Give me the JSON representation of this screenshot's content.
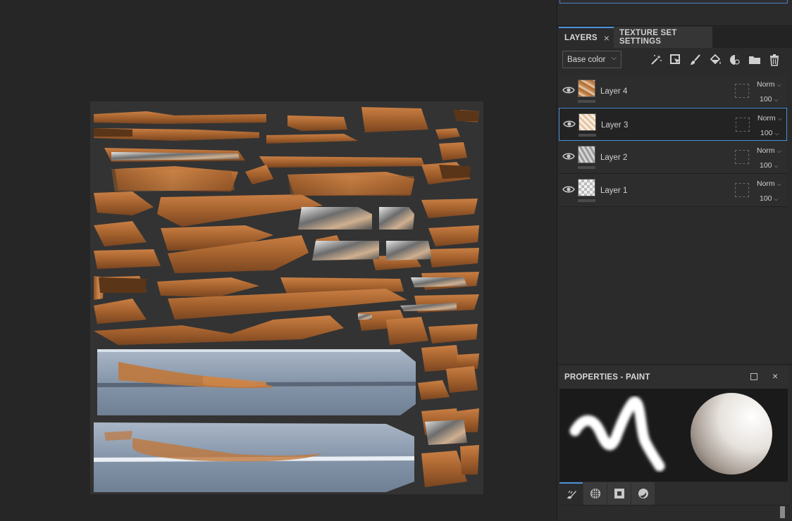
{
  "viewport": {
    "content": "uv-texture-map"
  },
  "layers_panel": {
    "tabs": [
      {
        "label": "LAYERS",
        "active": true
      },
      {
        "label": "TEXTURE SET SETTINGS",
        "active": false
      }
    ],
    "close_glyph": "×",
    "channel": {
      "selected": "Base color"
    },
    "tools": [
      "magic-wand-icon",
      "fill-layer-icon",
      "brush-icon",
      "paint-bucket-icon",
      "mask-icon",
      "folder-icon",
      "trash-icon"
    ],
    "layers": [
      {
        "name": "Layer 4",
        "blend": "Norm",
        "opacity": "100",
        "thumb": "brown",
        "selected": false
      },
      {
        "name": "Layer 3",
        "blend": "Norm",
        "opacity": "100",
        "thumb": "orange",
        "selected": true
      },
      {
        "name": "Layer 2",
        "blend": "Norm",
        "opacity": "100",
        "thumb": "gray",
        "selected": false
      },
      {
        "name": "Layer 1",
        "blend": "Norm",
        "opacity": "100",
        "thumb": "checker",
        "selected": false
      }
    ]
  },
  "properties_panel": {
    "title": "PROPERTIES - PAINT",
    "close_glyph": "×",
    "tabs": [
      "brush-tool-icon",
      "alpha-icon",
      "stencil-icon",
      "material-icon"
    ]
  },
  "colors": {
    "accent": "#4a90d9",
    "panel": "#2b2b2b",
    "viewport": "#262626",
    "uv_brown": "#b4703a",
    "uv_steel": "#8a9bb0"
  }
}
